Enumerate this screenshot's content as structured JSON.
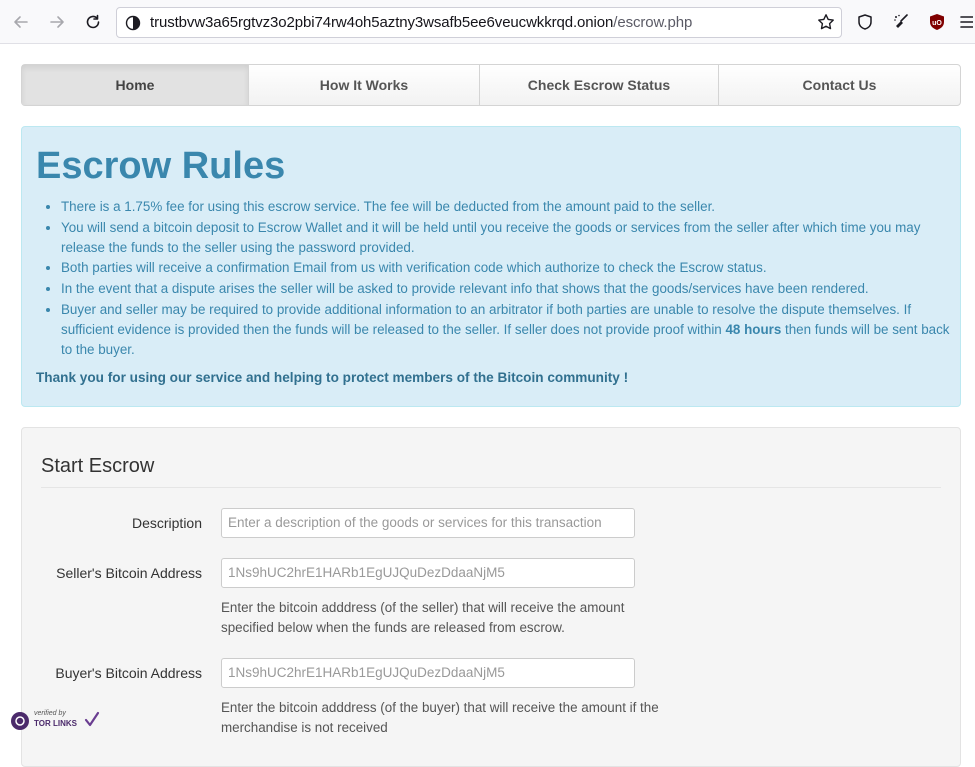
{
  "browser": {
    "url_domain": "trustbvw3a65rgtvz3o2pbi74rw4oh5aztny3wsafb5ee6veucwkkrqd.onion",
    "url_path": "/escrow.php",
    "icons": [
      "back-arrow-icon",
      "forward-arrow-icon",
      "reload-icon",
      "site-info-icon",
      "bookmark-star-icon",
      "shield-icon",
      "extension-broom-icon",
      "ublock-icon",
      "menu-icon"
    ]
  },
  "nav": {
    "items": [
      {
        "label": "Home",
        "active": true
      },
      {
        "label": "How It Works"
      },
      {
        "label": "Check Escrow Status"
      },
      {
        "label": "Contact Us"
      }
    ]
  },
  "rules": {
    "title": "Escrow Rules",
    "items": [
      "There is a 1.75% fee for using this escrow service. The fee will be deducted from the amount paid to the seller.",
      "You will send a bitcoin deposit to Escrow Wallet and it will be held until you receive the goods or services from the seller after which time you may release the funds to the seller using the password provided.",
      "Both parties will receive a confirmation Email from us with verification code which authorize to check the Escrow status.",
      "In the event that a dispute arises the seller will be asked to provide relevant info that shows that the goods/services have been rendered."
    ],
    "item5_pre": "Buyer and seller may be required to provide additional information to an arbitrator if both parties are unable to resolve the dispute themselves. If sufficient evidence is provided then the funds will be released to the seller. If seller does not provide proof within ",
    "item5_bold": "48 hours",
    "item5_post": " then funds will be sent back to the buyer.",
    "thanks": "Thank you for using our service and helping to protect members of the Bitcoin community !"
  },
  "form": {
    "title": "Start Escrow",
    "description_label": "Description",
    "description_placeholder": "Enter a description of the goods or services for this transaction",
    "seller_label": "Seller's Bitcoin Address",
    "seller_placeholder": "1Ns9hUC2hrE1HARb1EgUJQuDezDdaaNjM5",
    "seller_help": "Enter the bitcoin adddress (of the seller) that will receive the amount specified below when the funds are released from escrow.",
    "buyer_label": "Buyer's Bitcoin Address",
    "buyer_placeholder": "1Ns9hUC2hrE1HARb1EgUJQuDezDdaaNjM5",
    "buyer_help": "Enter the bitcoin adddress (of the buyer) that will receive the amount if the merchandise is not received"
  },
  "badge": {
    "line1": "verified by",
    "line2": "TOR LINKS"
  },
  "colors": {
    "alert_bg": "#d9edf7",
    "alert_text": "#3a87ad",
    "well_bg": "#f5f5f5",
    "ublock_red": "#800000"
  }
}
